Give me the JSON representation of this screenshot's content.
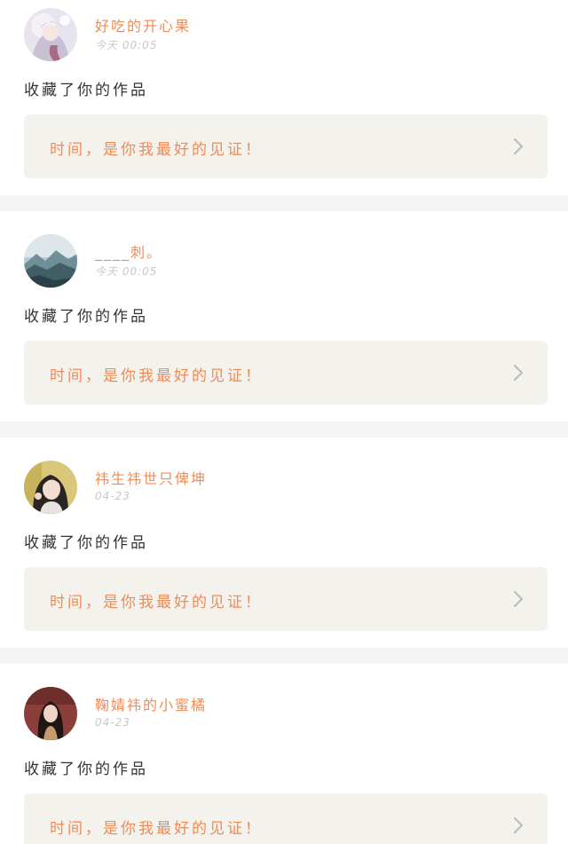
{
  "feed": {
    "items": [
      {
        "username": "好吃的开心果",
        "timestamp": "今天  00:05",
        "action": "收藏了你的作品",
        "work_title": "时间，是你我最好的见证！",
        "avatar_icon": "anime-girl-avatar"
      },
      {
        "username": "____刺。",
        "timestamp": "今天  00:05",
        "action": "收藏了你的作品",
        "work_title": "时间，是你我最好的见证！",
        "avatar_icon": "mountain-landscape-avatar"
      },
      {
        "username": "祎生祎世只俾坤",
        "timestamp": "04-23",
        "action": "收藏了你的作品",
        "work_title": "时间，是你我最好的见证！",
        "avatar_icon": "girl-selfie-avatar"
      },
      {
        "username": "鞠婧祎的小蜜橘",
        "timestamp": "04-23",
        "action": "收藏了你的作品",
        "work_title": "时间，是你我最好的见证！",
        "avatar_icon": "girl-portrait-avatar"
      }
    ]
  },
  "colors": {
    "accent": "#f08b55",
    "timestamp": "#c8c8c8",
    "card_box": "#f4f2ec",
    "separator": "#f5f5f5"
  }
}
